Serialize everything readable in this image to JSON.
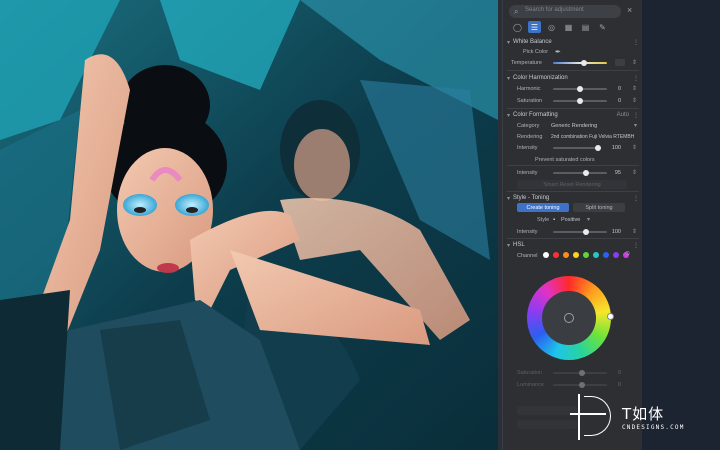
{
  "panel": {
    "search_placeholder": "Search for adjustment",
    "tools": [
      "circle-icon",
      "sliders-icon",
      "layers-icon",
      "grid-icon",
      "list-icon",
      "brush-icon"
    ],
    "white_balance": {
      "title": "White Balance",
      "picker_label": "Pick Color",
      "temperature_label": "Temperature"
    },
    "color_harmonization": {
      "title": "Color Harmonization",
      "rows": [
        {
          "label": "Harmonic",
          "value": "0"
        },
        {
          "label": "Saturation",
          "value": "0"
        }
      ]
    },
    "color_formatting": {
      "title": "Color Formatting",
      "right": "Auto",
      "category_label": "Category",
      "category_value": "Generic Rendering",
      "rendering_label": "Rendering",
      "rendering_value": "2nd combination Fuji Velvia RTEMBH",
      "intensity_label": "Intensity",
      "intensity_value": "100",
      "sub_title": "Prevent saturated colors"
    },
    "local": {
      "intensity_label": "Intensity",
      "intensity_value": "95",
      "btn_dim": "Smart Reset Rendering"
    },
    "style_toning": {
      "title": "Style - Toning",
      "btn_active": "Create toning",
      "btn_other": "Split toning",
      "style_label": "Style",
      "style_value": "Positive",
      "intensity_label": "Intensity",
      "intensity_value": "100"
    },
    "hsl": {
      "title": "HSL",
      "channel_label": "Channel",
      "swatches": [
        "#ffffff",
        "#ff3030",
        "#ff8c1a",
        "#ffd21f",
        "#5ed63a",
        "#27c6c4",
        "#2d5ff0",
        "#8a3cf0",
        "#d13ae0"
      ],
      "lower_rows": [
        {
          "label": "Saturation",
          "value": "0"
        },
        {
          "label": "Luminance",
          "value": "0"
        }
      ]
    }
  },
  "watermark": {
    "cn": "T如体",
    "en": "CNDESIGNS.COM"
  }
}
